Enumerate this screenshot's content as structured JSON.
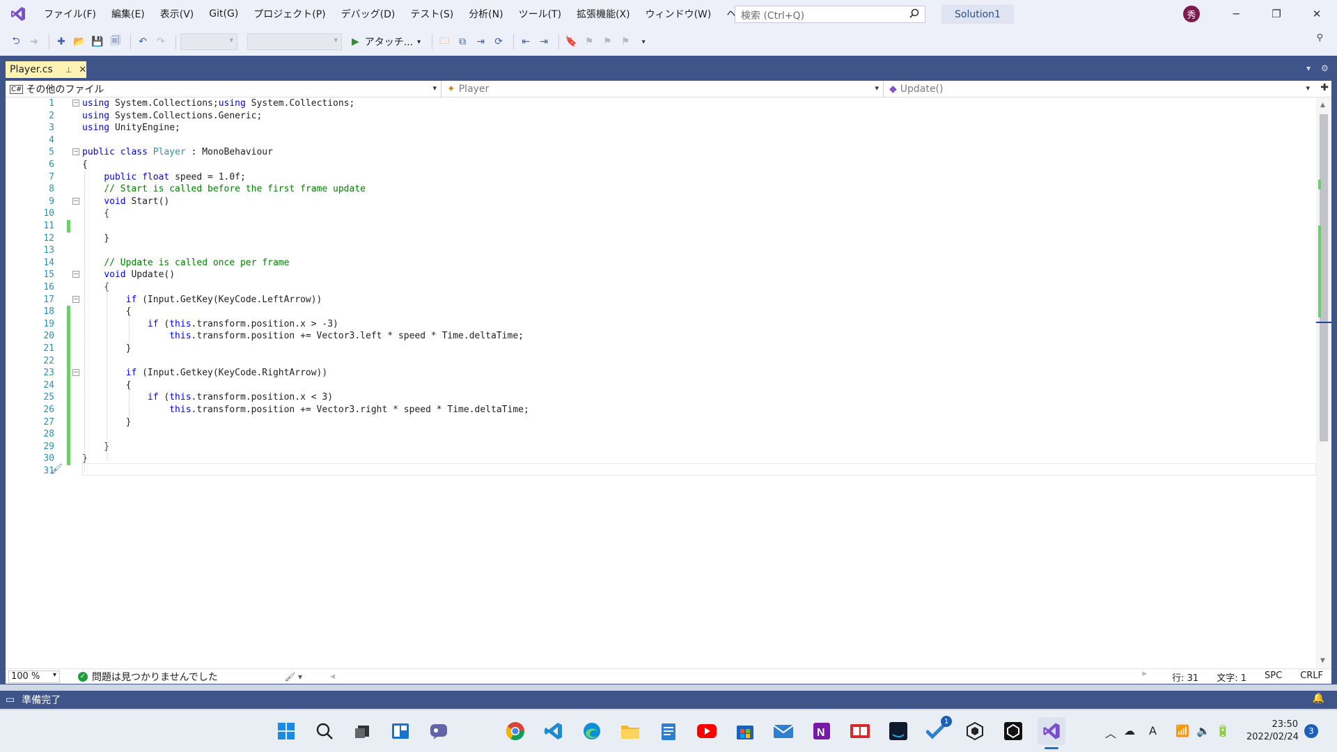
{
  "menubar": {
    "items": [
      "ファイル(F)",
      "編集(E)",
      "表示(V)",
      "Git(G)",
      "プロジェクト(P)",
      "デバッグ(D)",
      "テスト(S)",
      "分析(N)",
      "ツール(T)",
      "拡張機能(X)",
      "ウィンドウ(W)",
      "ヘルプ(H)"
    ],
    "search_placeholder": "検索 (Ctrl+Q)",
    "solution_name": "Solution1",
    "avatar_initial": "秀"
  },
  "toolbar": {
    "attach_label": "アタッチ..."
  },
  "editor": {
    "tab_title": "Player.cs",
    "nav_project": "その他のファイル",
    "nav_class": "Player",
    "nav_member": "Update()"
  },
  "code_lines": [
    {
      "n": "1",
      "text": "using System.Collections;using System.Collections;"
    },
    {
      "n": "2",
      "text": "using System.Collections.Generic;"
    },
    {
      "n": "3",
      "text": "using UnityEngine;"
    },
    {
      "n": "4",
      "text": ""
    },
    {
      "n": "5",
      "text": "public class Player : MonoBehaviour"
    },
    {
      "n": "6",
      "text": "{"
    },
    {
      "n": "7",
      "text": "    public float speed = 1.0f;"
    },
    {
      "n": "8",
      "text": "    // Start is called before the first frame update"
    },
    {
      "n": "9",
      "text": "    void Start()"
    },
    {
      "n": "10",
      "text": "    {"
    },
    {
      "n": "11",
      "text": ""
    },
    {
      "n": "12",
      "text": "    }"
    },
    {
      "n": "13",
      "text": ""
    },
    {
      "n": "14",
      "text": "    // Update is called once per frame"
    },
    {
      "n": "15",
      "text": "    void Update()"
    },
    {
      "n": "16",
      "text": "    {"
    },
    {
      "n": "17",
      "text": "        if (Input.GetKey(KeyCode.LeftArrow))"
    },
    {
      "n": "18",
      "text": "        {"
    },
    {
      "n": "19",
      "text": "            if (this.transform.position.x > -3)"
    },
    {
      "n": "20",
      "text": "                this.transform.position += Vector3.left * speed * Time.deltaTime;"
    },
    {
      "n": "21",
      "text": "        }"
    },
    {
      "n": "22",
      "text": ""
    },
    {
      "n": "23",
      "text": "        if (Input.Getkey(KeyCode.RightArrow))"
    },
    {
      "n": "24",
      "text": "        {"
    },
    {
      "n": "25",
      "text": "            if (this.transform.position.x < 3)"
    },
    {
      "n": "26",
      "text": "                this.transform.position += Vector3.right * speed * Time.deltaTime;"
    },
    {
      "n": "27",
      "text": "        }"
    },
    {
      "n": "28",
      "text": ""
    },
    {
      "n": "29",
      "text": "    }"
    },
    {
      "n": "30",
      "text": "}"
    },
    {
      "n": "31",
      "text": ""
    }
  ],
  "editor_footer": {
    "zoom": "100 %",
    "issues": "問題は見つかりませんでした",
    "line": "行: 31",
    "col": "文字: 1",
    "spc": "SPC",
    "crlf": "CRLF"
  },
  "statusbar": {
    "text": "準備完了"
  },
  "taskbar": {
    "time": "23:50",
    "date": "2022/02/24",
    "notif_count": "3",
    "todo_badge": "1"
  },
  "colors": {
    "accent": "#3f5488",
    "keyword": "#0000ff",
    "type": "#2b91af",
    "comment": "#008000",
    "tab_active": "#fff3b4"
  }
}
